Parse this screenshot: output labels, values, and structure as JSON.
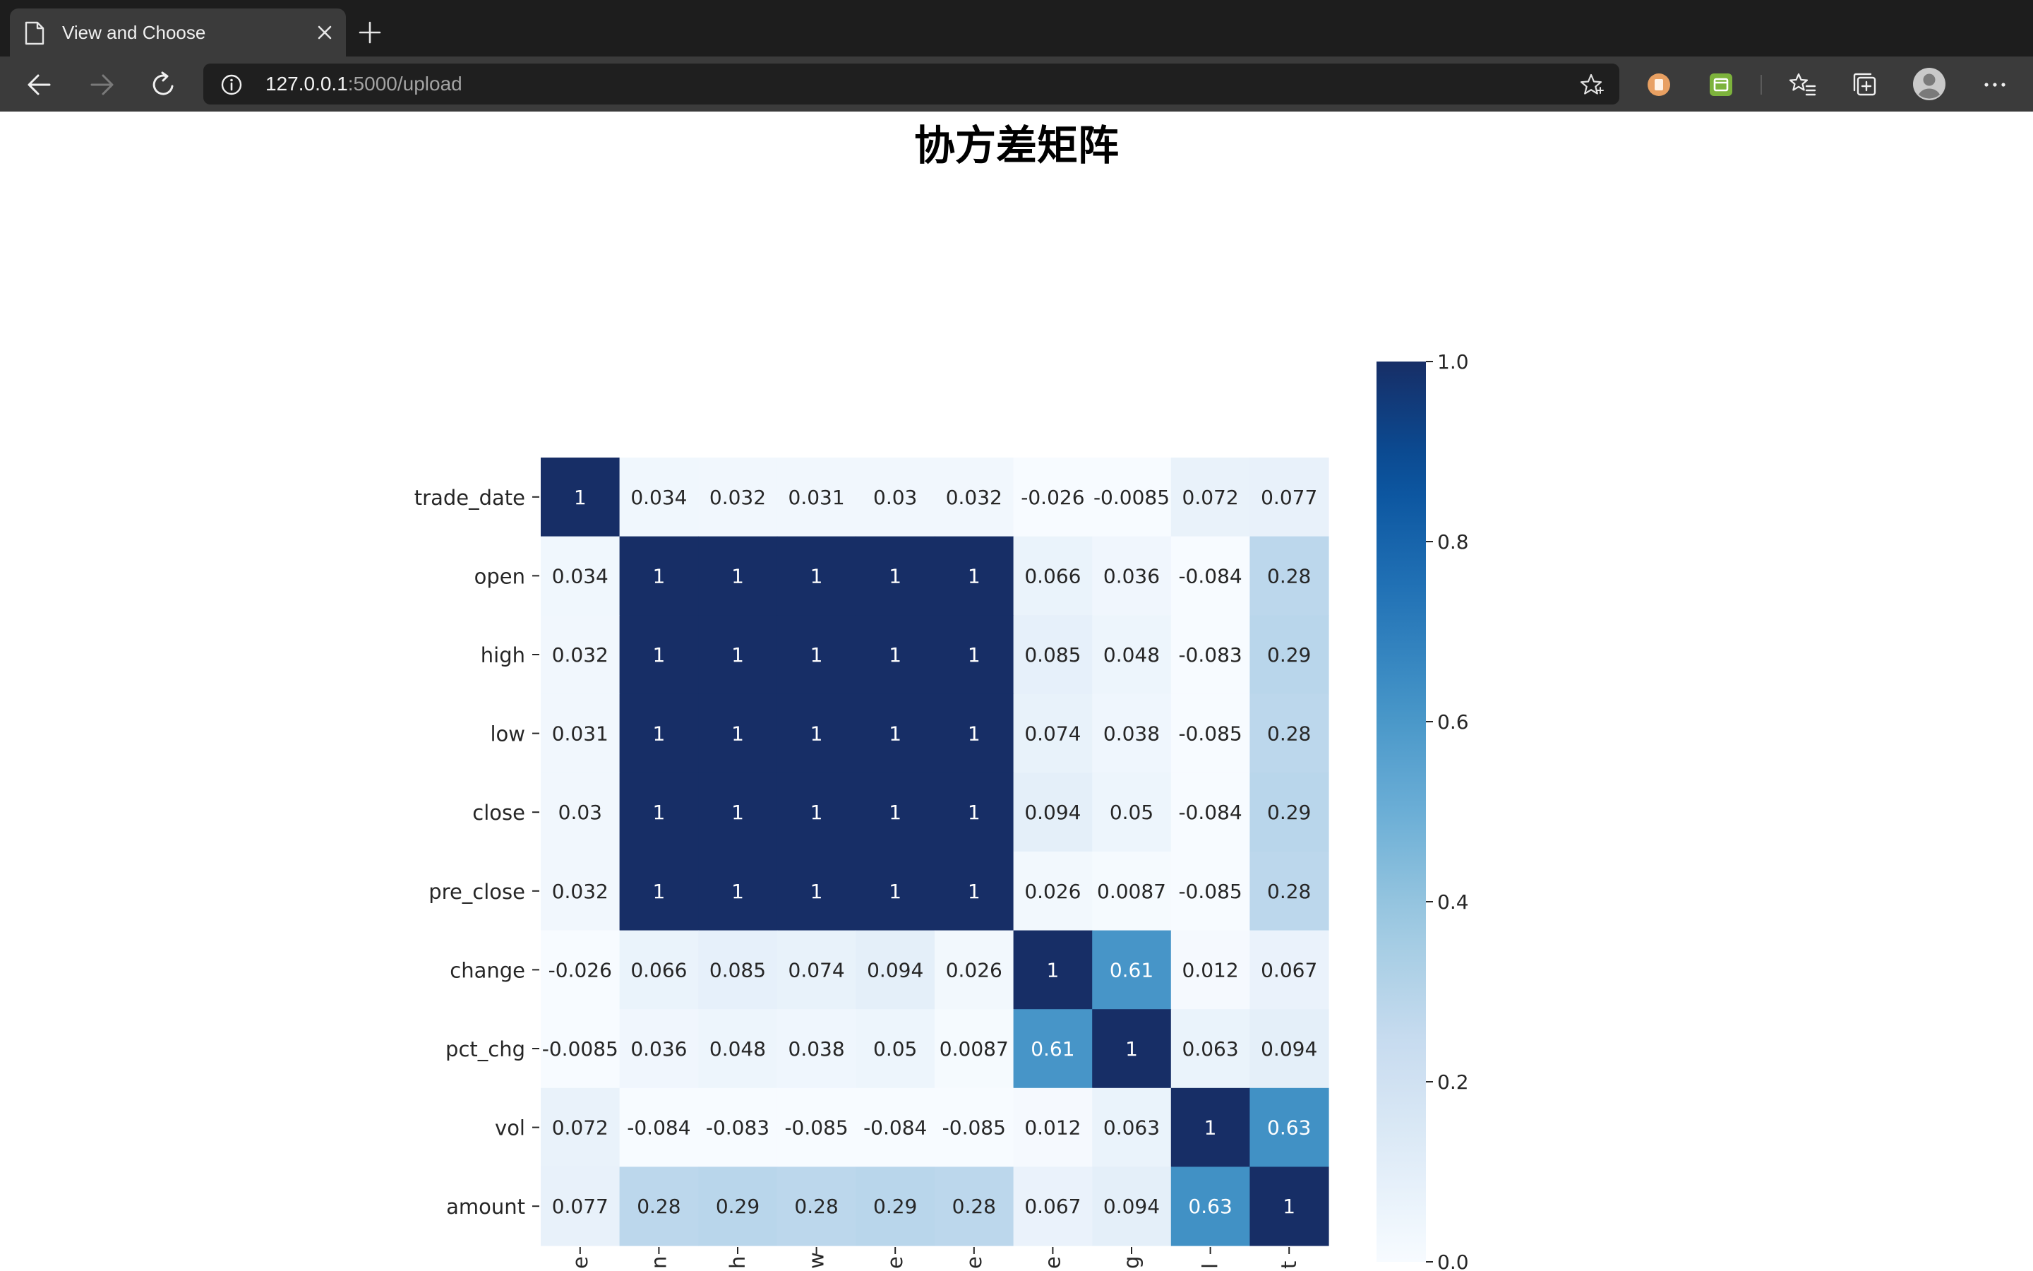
{
  "browser": {
    "tab_title": "View and Choose",
    "url_host": "127.0.0.1",
    "url_path": ":5000/upload",
    "icons": [
      "document-icon",
      "close-icon",
      "plus-icon",
      "back-icon",
      "forward-icon",
      "refresh-icon",
      "info-icon",
      "star-icon",
      "extension-icon",
      "extension-icon",
      "favorites-icon",
      "collections-icon",
      "profile-icon",
      "more-icon"
    ],
    "colors": {
      "titlebar": "#1d1d1d",
      "toolbar": "#3b3b3b",
      "omnibox": "#1f1f1f",
      "ext1": "#e8a062",
      "ext2": "#7db33c"
    }
  },
  "page": {
    "title": "协方差矩阵"
  },
  "chart_data": {
    "type": "heatmap",
    "rows": [
      "trade_date",
      "open",
      "high",
      "low",
      "close",
      "pre_close",
      "change",
      "pct_chg",
      "vol",
      "amount"
    ],
    "matrix": [
      [
        1,
        0.034,
        0.032,
        0.031,
        0.03,
        0.032,
        -0.026,
        -0.0085,
        0.072,
        0.077
      ],
      [
        0.034,
        1,
        1,
        1,
        1,
        1,
        0.066,
        0.036,
        -0.084,
        0.28
      ],
      [
        0.032,
        1,
        1,
        1,
        1,
        1,
        0.085,
        0.048,
        -0.083,
        0.29
      ],
      [
        0.031,
        1,
        1,
        1,
        1,
        1,
        0.074,
        0.038,
        -0.085,
        0.28
      ],
      [
        0.03,
        1,
        1,
        1,
        1,
        1,
        0.094,
        0.05,
        -0.084,
        0.29
      ],
      [
        0.032,
        1,
        1,
        1,
        1,
        1,
        0.026,
        0.0087,
        -0.085,
        0.28
      ],
      [
        -0.026,
        0.066,
        0.085,
        0.074,
        0.094,
        0.026,
        1,
        0.61,
        0.012,
        0.067
      ],
      [
        -0.0085,
        0.036,
        0.048,
        0.038,
        0.05,
        0.0087,
        0.61,
        1,
        0.063,
        0.094
      ],
      [
        0.072,
        -0.084,
        -0.083,
        -0.085,
        -0.084,
        -0.085,
        0.012,
        0.063,
        1,
        0.63
      ],
      [
        0.077,
        0.28,
        0.29,
        0.28,
        0.29,
        0.28,
        0.067,
        0.094,
        0.63,
        1
      ]
    ],
    "labels": [
      [
        "1",
        "0.034",
        "0.032",
        "0.031",
        "0.03",
        "0.032",
        "-0.026",
        "-0.0085",
        "0.072",
        "0.077"
      ],
      [
        "0.034",
        "1",
        "1",
        "1",
        "1",
        "1",
        "0.066",
        "0.036",
        "-0.084",
        "0.28"
      ],
      [
        "0.032",
        "1",
        "1",
        "1",
        "1",
        "1",
        "0.085",
        "0.048",
        "-0.083",
        "0.29"
      ],
      [
        "0.031",
        "1",
        "1",
        "1",
        "1",
        "1",
        "0.074",
        "0.038",
        "-0.085",
        "0.28"
      ],
      [
        "0.03",
        "1",
        "1",
        "1",
        "1",
        "1",
        "0.094",
        "0.05",
        "-0.084",
        "0.29"
      ],
      [
        "0.032",
        "1",
        "1",
        "1",
        "1",
        "1",
        "0.026",
        "0.0087",
        "-0.085",
        "0.28"
      ],
      [
        "-0.026",
        "0.066",
        "0.085",
        "0.074",
        "0.094",
        "0.026",
        "1",
        "0.61",
        "0.012",
        "0.067"
      ],
      [
        "-0.0085",
        "0.036",
        "0.048",
        "0.038",
        "0.05",
        "0.0087",
        "0.61",
        "1",
        "0.063",
        "0.094"
      ],
      [
        "0.072",
        "-0.084",
        "-0.083",
        "-0.085",
        "-0.084",
        "-0.085",
        "0.012",
        "0.063",
        "1",
        "0.63"
      ],
      [
        "0.077",
        "0.28",
        "0.29",
        "0.28",
        "0.29",
        "0.28",
        "0.067",
        "0.094",
        "0.63",
        "1"
      ]
    ],
    "colorbar": {
      "ticks": [
        "0.0",
        "0.2",
        "0.4",
        "0.6",
        "0.8",
        "1.0"
      ],
      "range": [
        0,
        1
      ]
    },
    "colormap": "Blues",
    "x_tick_fragments": [
      "e",
      "n",
      "h",
      "w",
      "e",
      "e",
      "e",
      "g",
      "l",
      "t"
    ]
  }
}
